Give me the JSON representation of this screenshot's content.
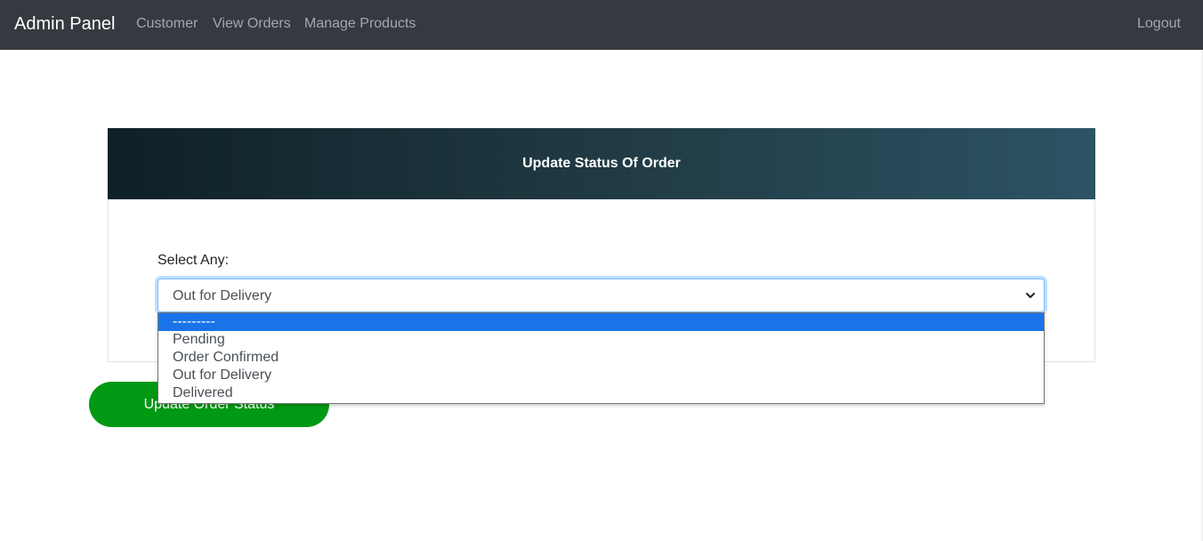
{
  "navbar": {
    "brand": "Admin Panel",
    "links": [
      "Customer",
      "View Orders",
      "Manage Products"
    ],
    "logout": "Logout",
    "background": "#343a40"
  },
  "card": {
    "title": "Update Status Of Order",
    "select_label": "Select Any:",
    "select_value": "Out for Delivery",
    "options": [
      "---------",
      "Pending",
      "Order Confirmed",
      "Out for Delivery",
      "Delivered"
    ],
    "highlighted_option": "---------",
    "header_gradient": [
      "#0f2027",
      "#203a43",
      "#2c5364"
    ]
  },
  "actions": {
    "update_label": "Update Order Status",
    "button_color": "#009913"
  },
  "icons": {
    "select_arrow": "chevron-down-icon"
  }
}
